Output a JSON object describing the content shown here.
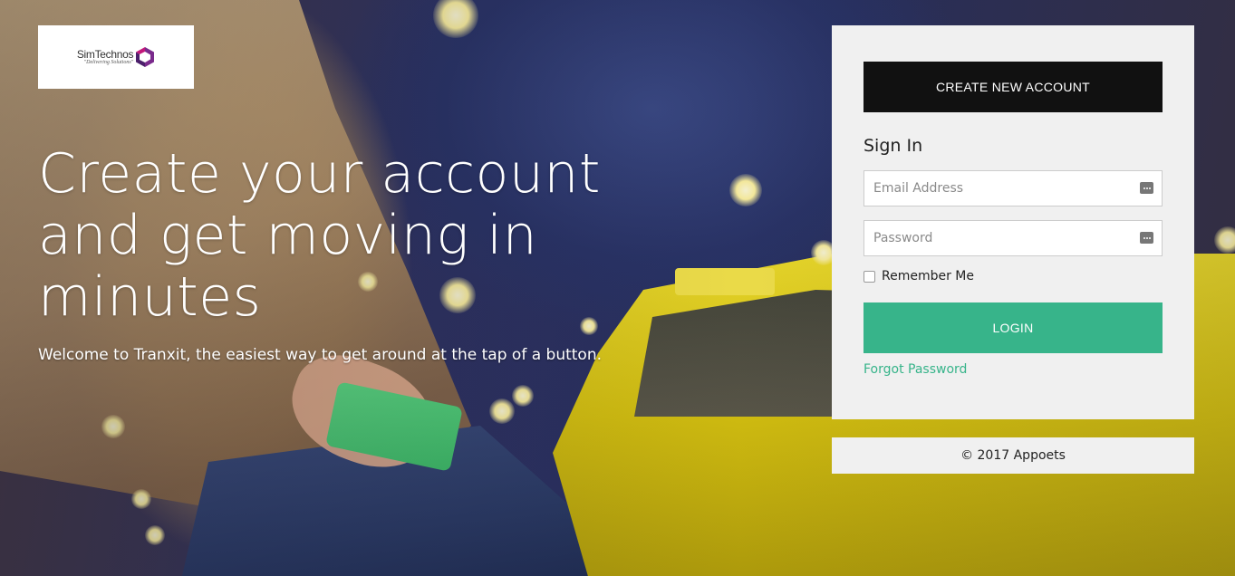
{
  "logo": {
    "name": "SimTechnos",
    "tagline": "\"Delivering Solutions\"",
    "accent_color": "#7a2a8c"
  },
  "hero": {
    "title": "Create your account and get moving in minutes",
    "subtitle": "Welcome to Tranxit, the easiest way to get around at the tap of a button."
  },
  "login_card": {
    "create_account_label": "CREATE NEW ACCOUNT",
    "signin_heading": "Sign In",
    "email_placeholder": "Email Address",
    "email_value": "",
    "password_placeholder": "Password",
    "password_value": "",
    "remember_label": "Remember Me",
    "remember_checked": false,
    "login_label": "LOGIN",
    "forgot_label": "Forgot Password",
    "field_icon": "keyboard-dots-icon"
  },
  "footer": {
    "copyright": "© 2017 Appoets"
  },
  "colors": {
    "primary_dark": "#111111",
    "accent_green": "#37b48a",
    "card_bg": "#f0f0f0"
  }
}
